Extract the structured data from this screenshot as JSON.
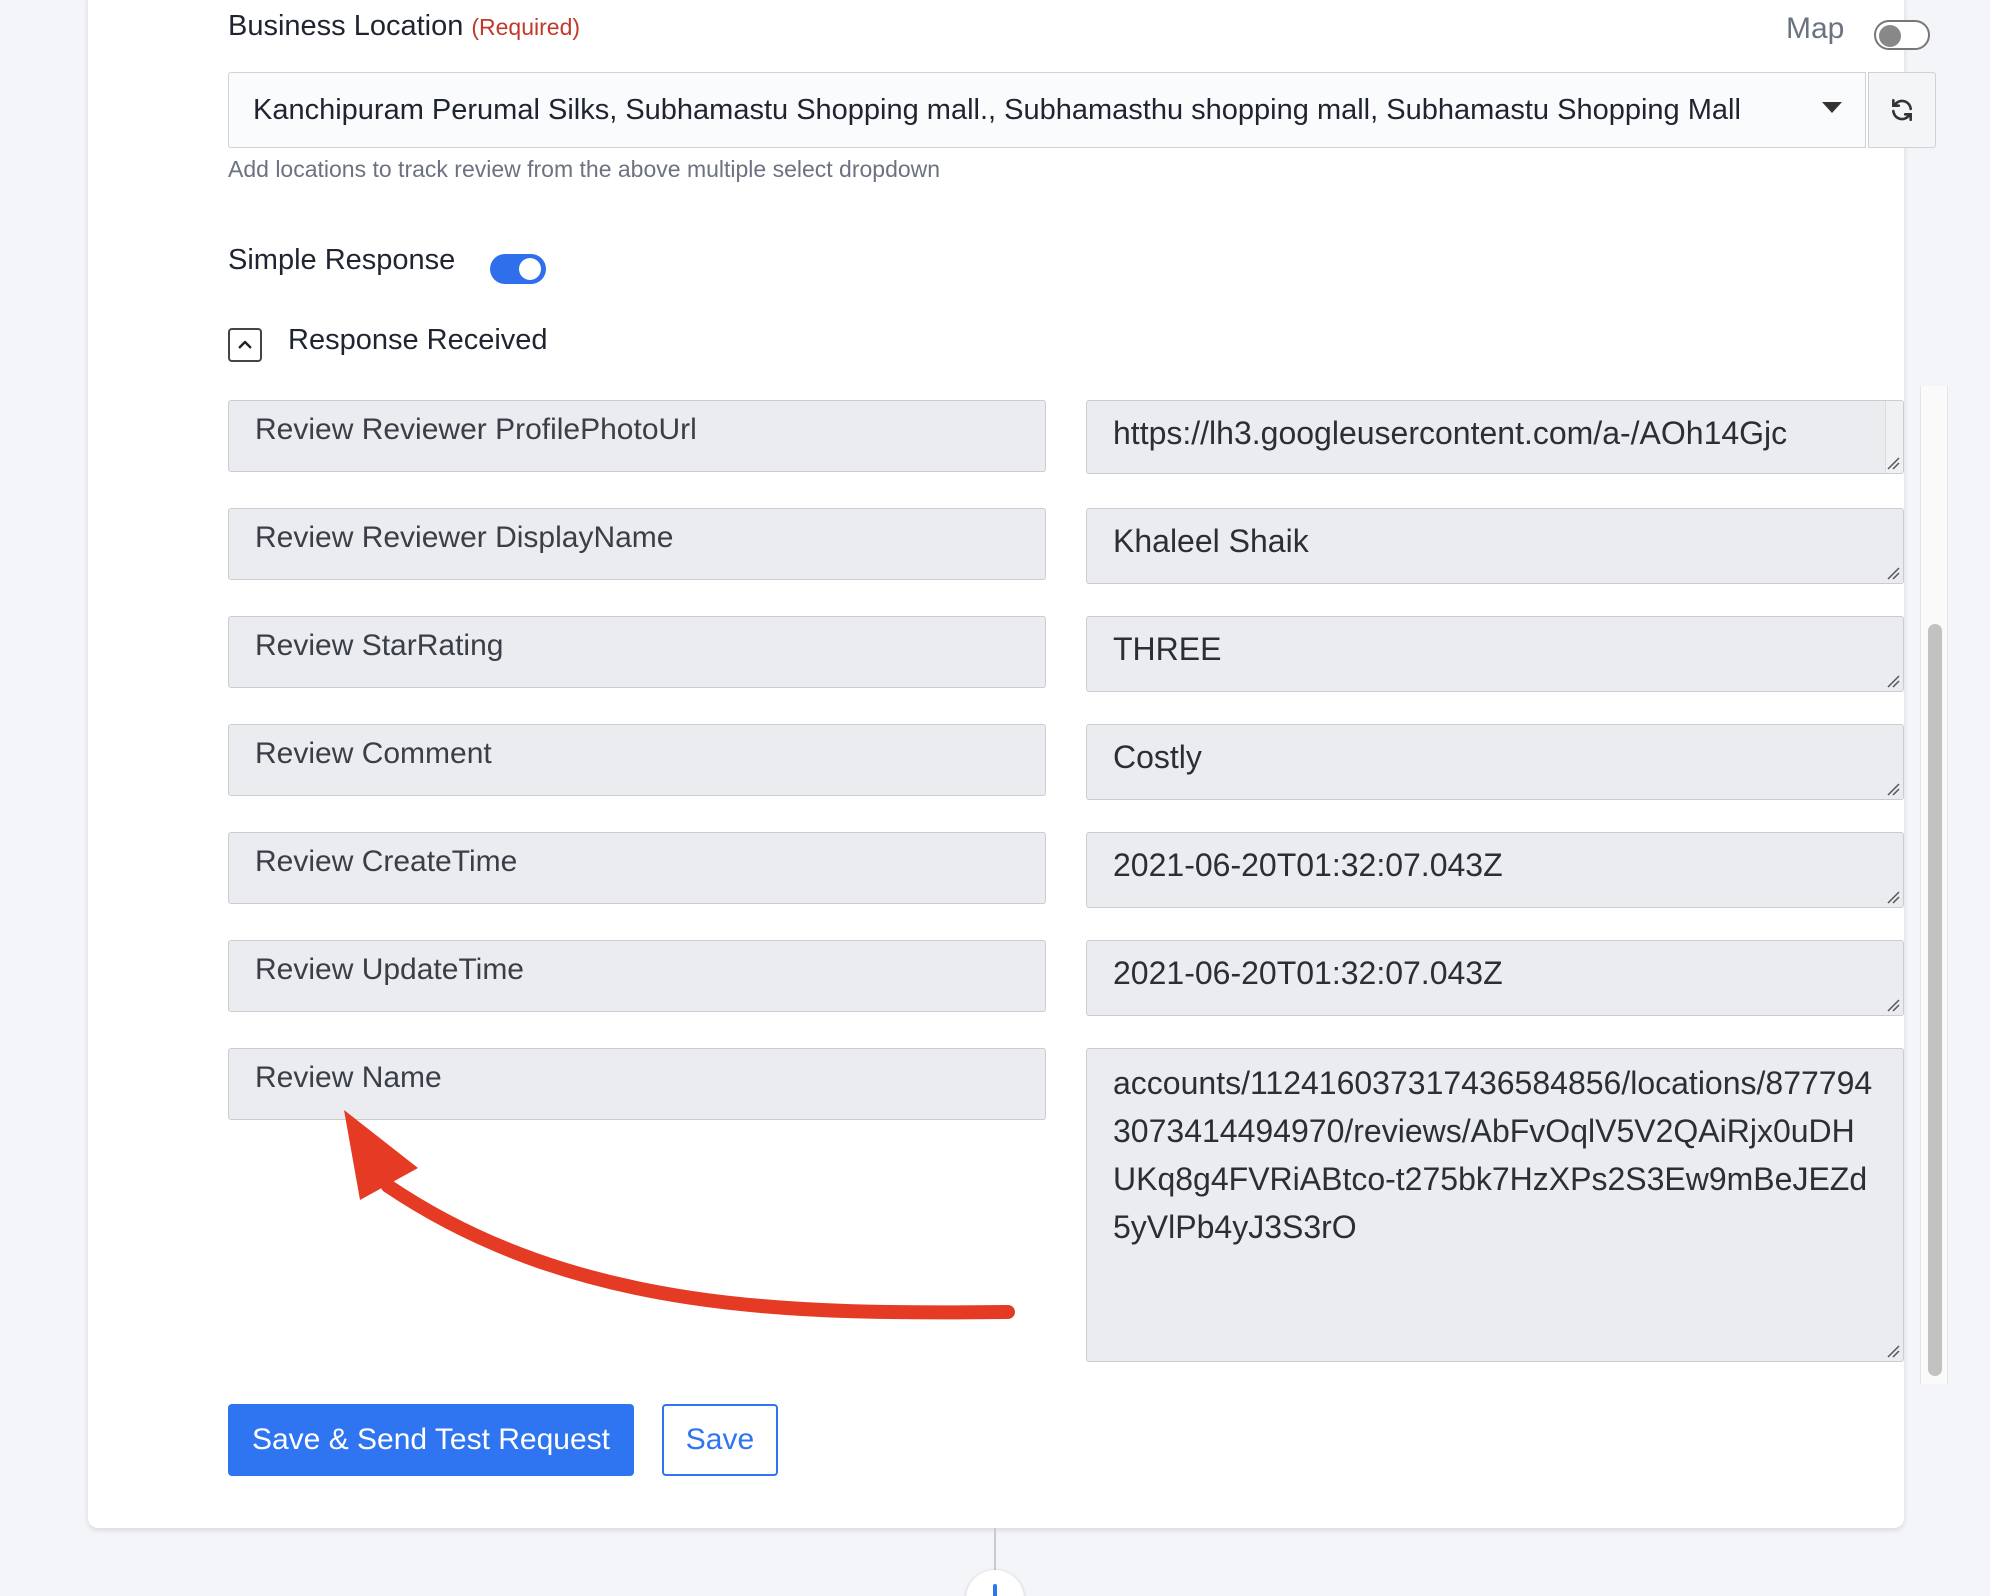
{
  "business_location": {
    "label": "Business Location",
    "required_text": "(Required)",
    "map_label": "Map",
    "selected_value": "Kanchipuram Perumal Silks, Subhamastu Shopping mall., Subhamasthu shopping mall, Subhamastu Shopping Mall",
    "hint": "Add locations to track review from the above multiple select dropdown"
  },
  "simple_response": {
    "label": "Simple Response",
    "enabled": true
  },
  "response_received": {
    "label": "Response Received",
    "expanded": true,
    "rows": [
      {
        "key": "Review Reviewer ProfilePhotoUrl",
        "value": "https://lh3.googleusercontent.com/a-/AOh14Gjc"
      },
      {
        "key": "Review Reviewer DisplayName",
        "value": "Khaleel Shaik"
      },
      {
        "key": "Review StarRating",
        "value": "THREE"
      },
      {
        "key": "Review Comment",
        "value": "Costly"
      },
      {
        "key": "Review CreateTime",
        "value": "2021-06-20T01:32:07.043Z"
      },
      {
        "key": "Review UpdateTime",
        "value": "2021-06-20T01:32:07.043Z"
      },
      {
        "key": "Review Name",
        "value": "accounts/112416037317436584856/locations/8777943073414494970/reviews/AbFvOqlV5V2QAiRjx0uDHUKq8g4FVRiABtco-t275bk7HzXPs2S3Ew9mBeJEZd5yVlPb4yJ3S3rO"
      }
    ]
  },
  "actions": {
    "save_send_label": "Save & Send Test Request",
    "save_label": "Save"
  },
  "colors": {
    "primary": "#2f74f0",
    "required": "#c0392b",
    "annotation_arrow": "#e53b24"
  },
  "icons": [
    "chevron-up-icon",
    "caret-down-icon",
    "refresh-icon",
    "resize-grip-icon"
  ]
}
